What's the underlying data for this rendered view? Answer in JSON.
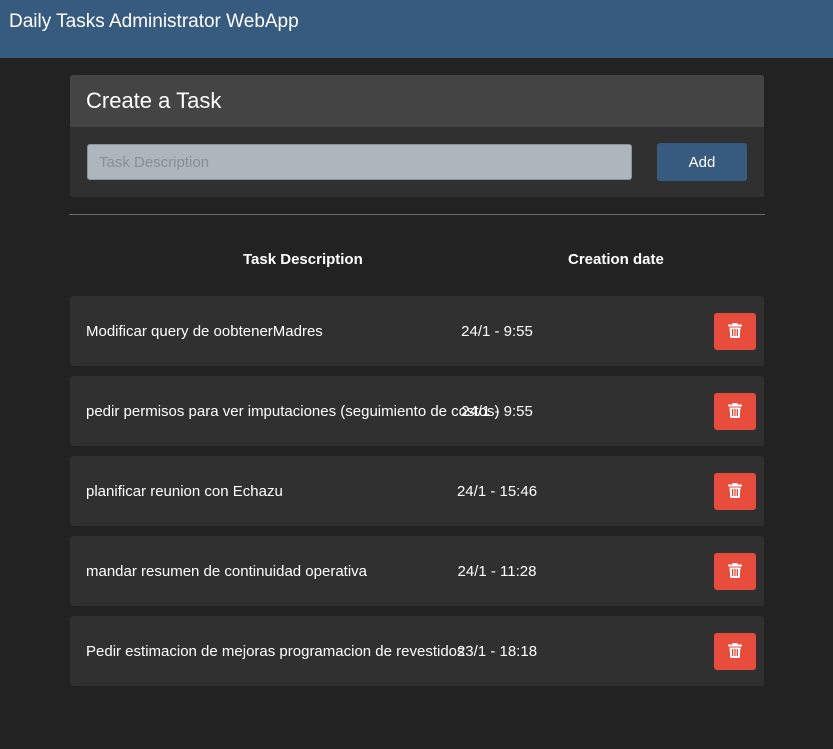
{
  "app": {
    "title": "Daily Tasks Administrator WebApp"
  },
  "create_card": {
    "title": "Create a Task",
    "input_placeholder": "Task Description",
    "input_value": "",
    "add_label": "Add"
  },
  "table": {
    "headers": {
      "description": "Task Description",
      "date": "Creation date"
    },
    "rows": [
      {
        "description": "Modificar query de oobtenerMadres",
        "date": "24/1 - 9:55"
      },
      {
        "description": "pedir permisos para ver imputaciones (seguimiento de costos)",
        "date": "24/1 - 9:55"
      },
      {
        "description": "planificar reunion con Echazu",
        "date": "24/1 - 15:46"
      },
      {
        "description": "mandar resumen de continuidad operativa",
        "date": "24/1 - 11:28"
      },
      {
        "description": "Pedir estimacion de mejoras programacion de revestidos",
        "date": "23/1 - 18:18"
      }
    ]
  },
  "icons": {
    "delete": "trash-icon"
  },
  "colors": {
    "navbar": "#375a7f",
    "danger": "#e74c3c",
    "background": "#222222",
    "card": "#303030"
  }
}
